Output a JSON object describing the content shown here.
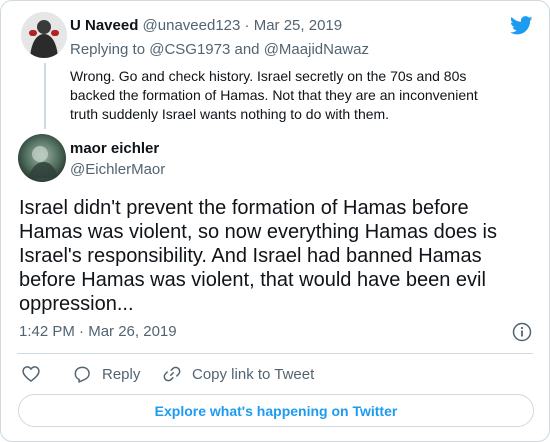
{
  "replied_tweet": {
    "author_name": "U Naveed",
    "author_handle": "@unaveed123",
    "separator": "·",
    "date": "Mar 25, 2019",
    "replying_prefix": "Replying to",
    "reply_to_1": "@CSG1973",
    "reply_and": "and",
    "reply_to_2": "@MaajidNawaz",
    "text_lines": [
      "Wrong. Go and check history. Israel secretly on the 70s and 80s",
      "backed the formation of Hamas. Not that they are an inconvenient",
      "truth suddenly Israel wants nothing to do with them."
    ]
  },
  "main_tweet": {
    "author_name": "maor eichler",
    "author_handle": "@EichlerMaor",
    "text_lines": [
      "Israel didn't prevent the formation of Hamas before",
      "Hamas was violent, so now everything Hamas does is",
      "Israel's responsibility. And Israel had banned Hamas",
      "before Hamas was violent, that would have been evil",
      "oppression..."
    ],
    "time": "1:42 PM",
    "separator": "·",
    "date": "Mar 26, 2019"
  },
  "actions": {
    "reply_label": "Reply",
    "copy_link_label": "Copy link to Tweet"
  },
  "explore_label": "Explore what's happening on Twitter",
  "colors": {
    "twitter_blue": "#1d9bf0",
    "muted_text": "#536471",
    "border": "#cfd9de"
  },
  "icons": [
    "twitter-bird-icon",
    "info-icon",
    "heart-icon",
    "reply-icon",
    "link-icon"
  ]
}
